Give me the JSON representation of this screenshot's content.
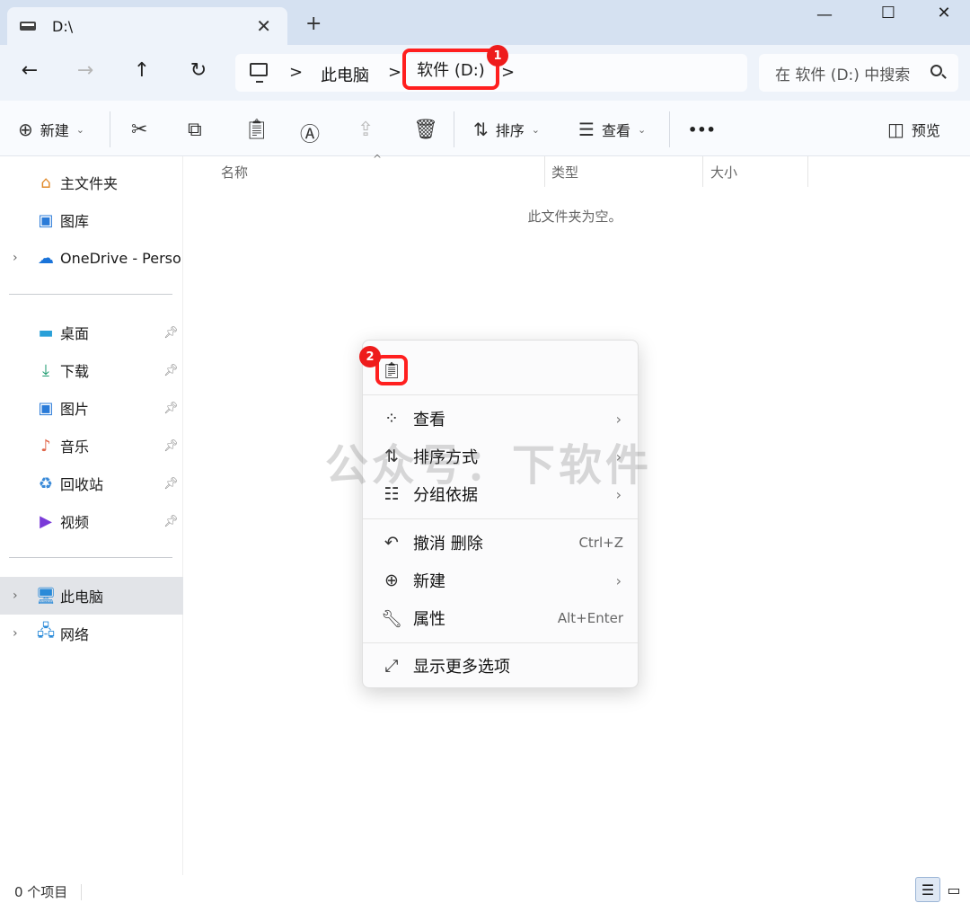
{
  "tab": {
    "title": "D:\\",
    "close_label": "✕",
    "new_tab_label": "+"
  },
  "window": {
    "minimize": "—",
    "maximize": "☐",
    "close": "✕"
  },
  "nav": {
    "back": "←",
    "forward": "→",
    "up": "↑",
    "refresh": "↻"
  },
  "address": {
    "crumbs": [
      "此电脑",
      "软件 (D:)"
    ],
    "separator": ">",
    "badge1": "1"
  },
  "search": {
    "placeholder": "在 软件 (D:) 中搜索"
  },
  "toolbar": {
    "new_label": "新建",
    "sort_label": "排序",
    "view_label": "查看",
    "more_label": "•••",
    "preview_label": "预览",
    "icons": [
      "cut-icon",
      "copy-icon",
      "paste-icon",
      "rename-icon",
      "share-icon",
      "delete-icon"
    ]
  },
  "sidebar": {
    "top": [
      {
        "label": "主文件夹",
        "icon": "home-icon"
      },
      {
        "label": "图库",
        "icon": "gallery-icon"
      },
      {
        "label": "OneDrive - Personal",
        "icon": "cloud-icon"
      }
    ],
    "pinned": [
      {
        "label": "桌面",
        "icon": "desktop-icon"
      },
      {
        "label": "下载",
        "icon": "download-icon"
      },
      {
        "label": "图片",
        "icon": "pictures-icon"
      },
      {
        "label": "音乐",
        "icon": "music-icon"
      },
      {
        "label": "回收站",
        "icon": "recycle-bin-icon"
      },
      {
        "label": "视频",
        "icon": "videos-icon"
      }
    ],
    "bottom": [
      {
        "label": "此电脑",
        "icon": "this-pc-icon"
      },
      {
        "label": "网络",
        "icon": "network-icon"
      }
    ]
  },
  "columns": {
    "name": "名称",
    "type": "类型",
    "size": "大小"
  },
  "empty_message": "此文件夹为空。",
  "context_menu": {
    "badge2": "2",
    "items": [
      {
        "label": "查看",
        "key": ""
      },
      {
        "label": "排序方式",
        "key": ""
      },
      {
        "label": "分组依据",
        "key": ""
      },
      {
        "label": "撤消 删除",
        "key": "Ctrl+Z"
      },
      {
        "label": "新建",
        "key": ""
      },
      {
        "label": "属性",
        "key": "Alt+Enter"
      },
      {
        "label": "显示更多选项",
        "key": ""
      }
    ]
  },
  "watermark": "公众号：下软件",
  "status": {
    "items": "0 个项目"
  }
}
